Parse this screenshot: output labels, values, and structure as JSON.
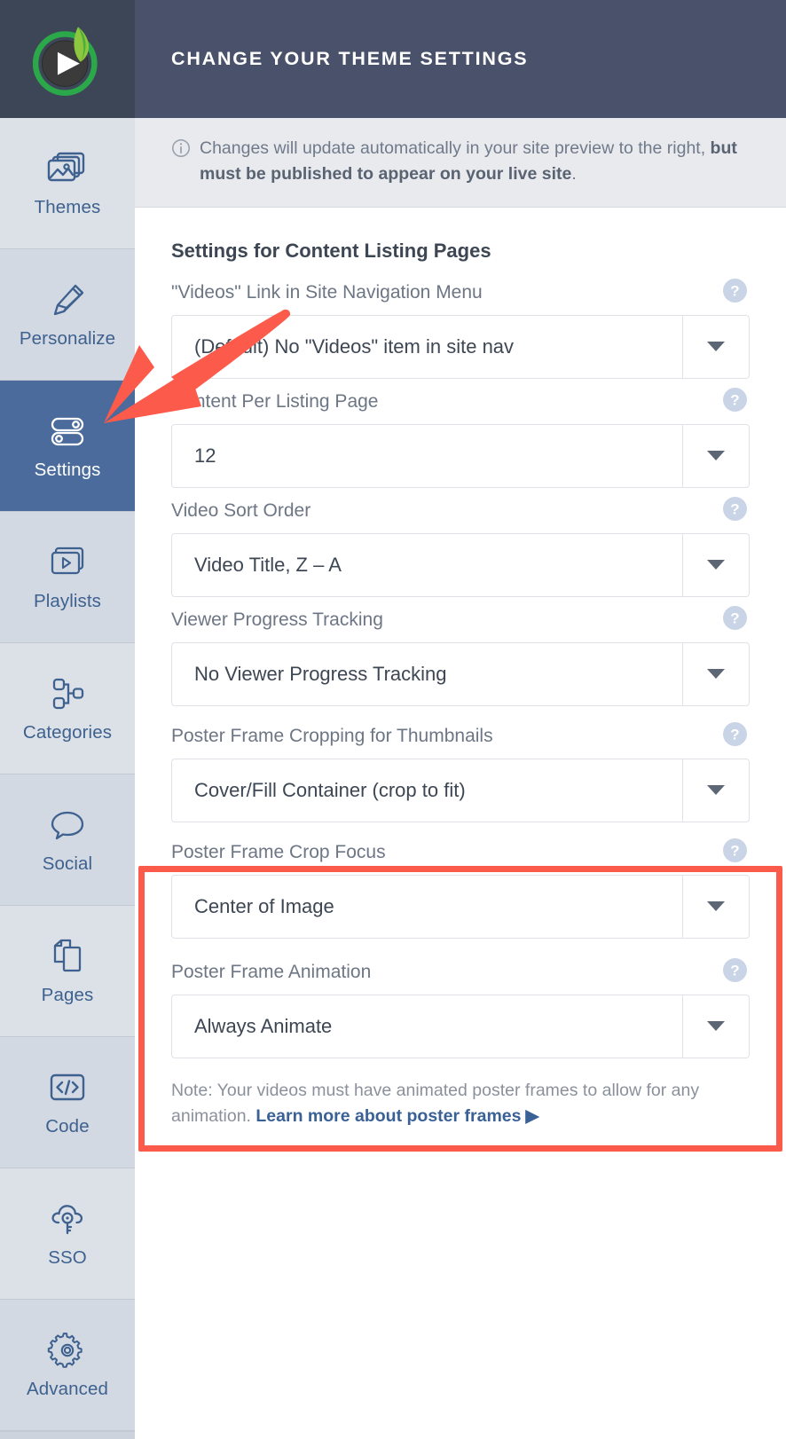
{
  "brand": {
    "logo_icon": "sprout-video-play-logo"
  },
  "header": {
    "title": "CHANGE YOUR THEME SETTINGS"
  },
  "notice": {
    "icon": "info-circle-icon",
    "text_part1": "Changes will update automatically in your site preview to the right, ",
    "text_bold": "but must be published to appear on your live site",
    "text_end": "."
  },
  "sidebar": {
    "items": [
      {
        "label": "Themes",
        "icon": "images-icon",
        "active": false
      },
      {
        "label": "Personalize",
        "icon": "pencil-icon",
        "active": false
      },
      {
        "label": "Settings",
        "icon": "toggles-icon",
        "active": true
      },
      {
        "label": "Playlists",
        "icon": "video-stack-icon",
        "active": false
      },
      {
        "label": "Categories",
        "icon": "sitemap-icon",
        "active": false
      },
      {
        "label": "Social",
        "icon": "speech-bubble-icon",
        "active": false
      },
      {
        "label": "Pages",
        "icon": "documents-icon",
        "active": false
      },
      {
        "label": "Code",
        "icon": "code-brackets-icon",
        "active": false
      },
      {
        "label": "SSO",
        "icon": "cloud-key-icon",
        "active": false
      },
      {
        "label": "Advanced",
        "icon": "gear-icon",
        "active": false
      }
    ]
  },
  "main": {
    "section_title": "Settings for Content Listing Pages",
    "fields": [
      {
        "label": "\"Videos\" Link in Site Navigation Menu",
        "value": "(Default) No \"Videos\" item in site nav",
        "help": "?"
      },
      {
        "label": "Content Per Listing Page",
        "value": "12",
        "help": "?"
      },
      {
        "label": "Video Sort Order",
        "value": "Video Title, Z – A",
        "help": "?"
      },
      {
        "label": "Viewer Progress Tracking",
        "value": "No Viewer Progress Tracking",
        "help": "?"
      },
      {
        "label": "Poster Frame Cropping for Thumbnails",
        "value": "Cover/Fill Container (crop to fit)",
        "help": "?"
      },
      {
        "label": "Poster Frame Crop Focus",
        "value": "Center of Image",
        "help": "?"
      },
      {
        "label": "Poster Frame Animation",
        "value": "Always Animate",
        "help": "?"
      }
    ],
    "note": {
      "text": "Note: Your videos must have animated poster frames to allow for any animation. ",
      "link_text": "Learn more about poster frames",
      "link_arrow": "▶"
    }
  },
  "annotations": {
    "highlight_color": "#fc5b4b",
    "arrow_color": "#fc5b4b",
    "arrow_target": "sidebar-item-settings",
    "highlight_targets": [
      "Poster Frame Cropping for Thumbnails",
      "Poster Frame Crop Focus"
    ]
  }
}
